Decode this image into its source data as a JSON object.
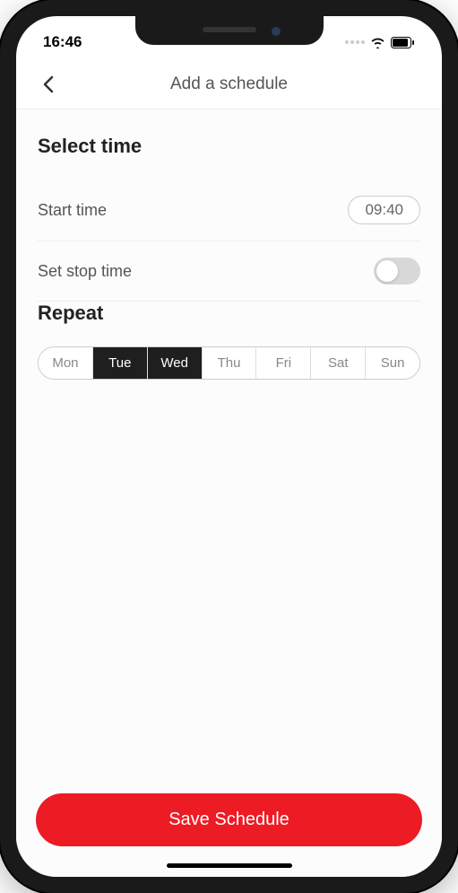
{
  "status": {
    "time": "16:46"
  },
  "nav": {
    "title": "Add a schedule"
  },
  "time_section": {
    "title": "Select time",
    "start_label": "Start time",
    "start_value": "09:40",
    "stop_label": "Set stop time",
    "stop_enabled": false
  },
  "repeat": {
    "title": "Repeat",
    "days": [
      {
        "label": "Mon",
        "selected": false
      },
      {
        "label": "Tue",
        "selected": true
      },
      {
        "label": "Wed",
        "selected": true
      },
      {
        "label": "Thu",
        "selected": false
      },
      {
        "label": "Fri",
        "selected": false
      },
      {
        "label": "Sat",
        "selected": false
      },
      {
        "label": "Sun",
        "selected": false
      }
    ]
  },
  "save_label": "Save Schedule",
  "colors": {
    "accent": "#ed1b24"
  }
}
